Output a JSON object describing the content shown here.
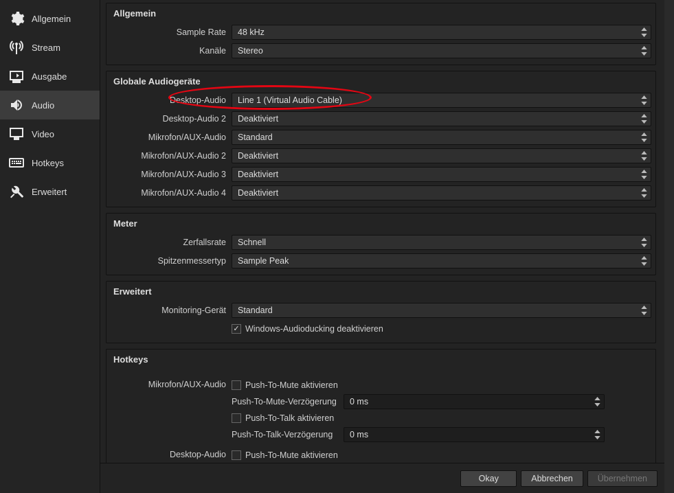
{
  "sidebar": {
    "items": [
      {
        "id": "allgemein",
        "label": "Allgemein"
      },
      {
        "id": "stream",
        "label": "Stream"
      },
      {
        "id": "ausgabe",
        "label": "Ausgabe"
      },
      {
        "id": "audio",
        "label": "Audio"
      },
      {
        "id": "video",
        "label": "Video"
      },
      {
        "id": "hotkeys",
        "label": "Hotkeys"
      },
      {
        "id": "erweitert",
        "label": "Erweitert"
      }
    ],
    "active": "audio"
  },
  "sections": {
    "allgemein": {
      "title": "Allgemein",
      "sample_rate_label": "Sample Rate",
      "sample_rate_value": "48 kHz",
      "kanaele_label": "Kanäle",
      "kanaele_value": "Stereo"
    },
    "geraete": {
      "title": "Globale Audiogeräte",
      "rows": [
        {
          "label": "Desktop-Audio",
          "value": "Line 1 (Virtual Audio Cable)"
        },
        {
          "label": "Desktop-Audio 2",
          "value": "Deaktiviert"
        },
        {
          "label": "Mikrofon/AUX-Audio",
          "value": "Standard"
        },
        {
          "label": "Mikrofon/AUX-Audio 2",
          "value": "Deaktiviert"
        },
        {
          "label": "Mikrofon/AUX-Audio 3",
          "value": "Deaktiviert"
        },
        {
          "label": "Mikrofon/AUX-Audio 4",
          "value": "Deaktiviert"
        }
      ]
    },
    "meter": {
      "title": "Meter",
      "zerfall_label": "Zerfallsrate",
      "zerfall_value": "Schnell",
      "spitzen_label": "Spitzenmessertyp",
      "spitzen_value": "Sample Peak"
    },
    "erweitert": {
      "title": "Erweitert",
      "mon_label": "Monitoring-Gerät",
      "mon_value": "Standard",
      "ducking_label": "Windows-Audioducking deaktivieren",
      "ducking_checked": true
    },
    "hotkeys": {
      "title": "Hotkeys",
      "mic_label": "Mikrofon/AUX-Audio",
      "desk_label": "Desktop-Audio",
      "ptm_label": "Push-To-Mute aktivieren",
      "ptm_delay_label": "Push-To-Mute-Verzögerung",
      "ptm_delay_value": "0 ms",
      "ptt_label": "Push-To-Talk aktivieren",
      "ptt_delay_label": "Push-To-Talk-Verzögerung",
      "ptt_delay_value": "0 ms"
    }
  },
  "buttons": {
    "ok": "Okay",
    "cancel": "Abbrechen",
    "apply": "Übernehmen"
  }
}
